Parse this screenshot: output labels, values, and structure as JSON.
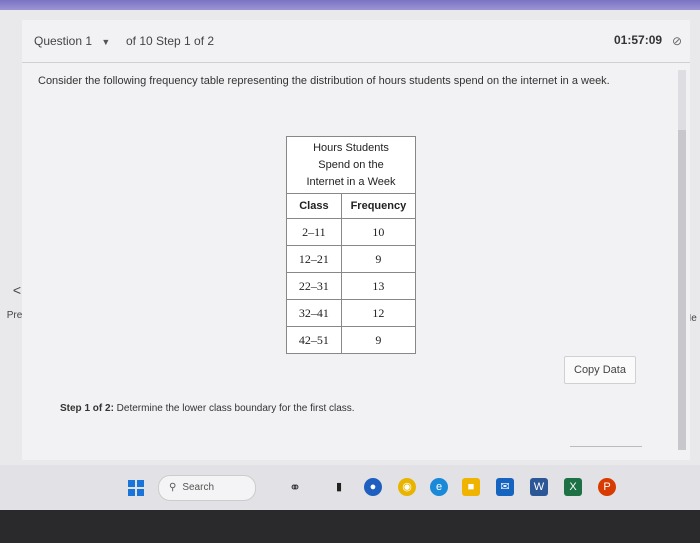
{
  "question": {
    "selector": "Question 1",
    "progress": "of 10 Step 1 of 2",
    "timer": "01:57:09"
  },
  "prompt": "Consider the following frequency table representing the distribution of hours students spend on the internet in a week.",
  "table": {
    "caption": [
      "Hours Students",
      "Spend on the",
      "Internet in a Week"
    ],
    "headers": [
      "Class",
      "Frequency"
    ],
    "rows": [
      [
        "2–11",
        "10"
      ],
      [
        "12–21",
        "9"
      ],
      [
        "22–31",
        "13"
      ],
      [
        "32–41",
        "12"
      ],
      [
        "42–51",
        "9"
      ]
    ]
  },
  "copy_button": "Copy Data",
  "step": {
    "label": "Step 1 of 2:",
    "text": " Determine the lower class boundary for the first class."
  },
  "nav": {
    "prev_label": "Prev",
    "next_label": "Ne"
  },
  "taskbar": {
    "search_label": "Search"
  }
}
